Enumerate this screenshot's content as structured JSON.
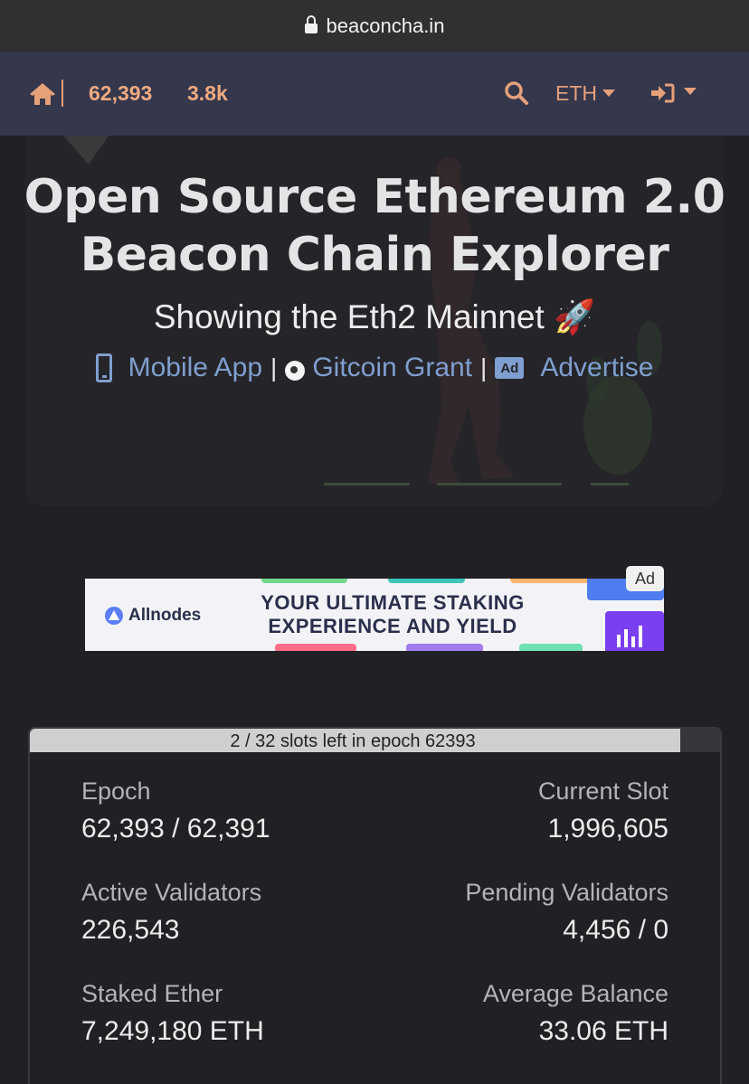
{
  "browser": {
    "url": "beaconcha.in"
  },
  "nav": {
    "epoch": "62,393",
    "price_stat": "3.8k",
    "currency": "ETH"
  },
  "hero": {
    "title_line1": "Open Source Ethereum 2.0",
    "title_line2": "Beacon Chain Explorer",
    "subtitle": "Showing the Eth2 Mainnet 🚀",
    "links": {
      "mobile_app": "Mobile App",
      "gitcoin": "Gitcoin Grant",
      "advertise": "Advertise",
      "ad_icon": "Ad",
      "separator": "|"
    }
  },
  "ad": {
    "badge": "Ad",
    "brand": "Allnodes",
    "headline_line1": "YOUR ULTIMATE STAKING",
    "headline_line2": "EXPERIENCE AND YIELD"
  },
  "epoch_progress": {
    "label": "2 / 32 slots left in epoch 62393",
    "fraction_complete": 0.9375
  },
  "stats": {
    "epoch_label": "Epoch",
    "epoch_value": "62,393 / 62,391",
    "current_slot_label": "Current Slot",
    "current_slot_value": "1,996,605",
    "active_validators_label": "Active Validators",
    "active_validators_value": "226,543",
    "pending_validators_label": "Pending Validators",
    "pending_validators_value": "4,456 / 0",
    "staked_ether_label": "Staked Ether",
    "staked_ether_value": "7,249,180 ETH",
    "average_balance_label": "Average Balance",
    "average_balance_value": "33.06 ETH"
  },
  "colors": {
    "background": "#212024",
    "navbar": "#35374d",
    "accent": "#e6a07a",
    "link": "#7f9fd0"
  }
}
